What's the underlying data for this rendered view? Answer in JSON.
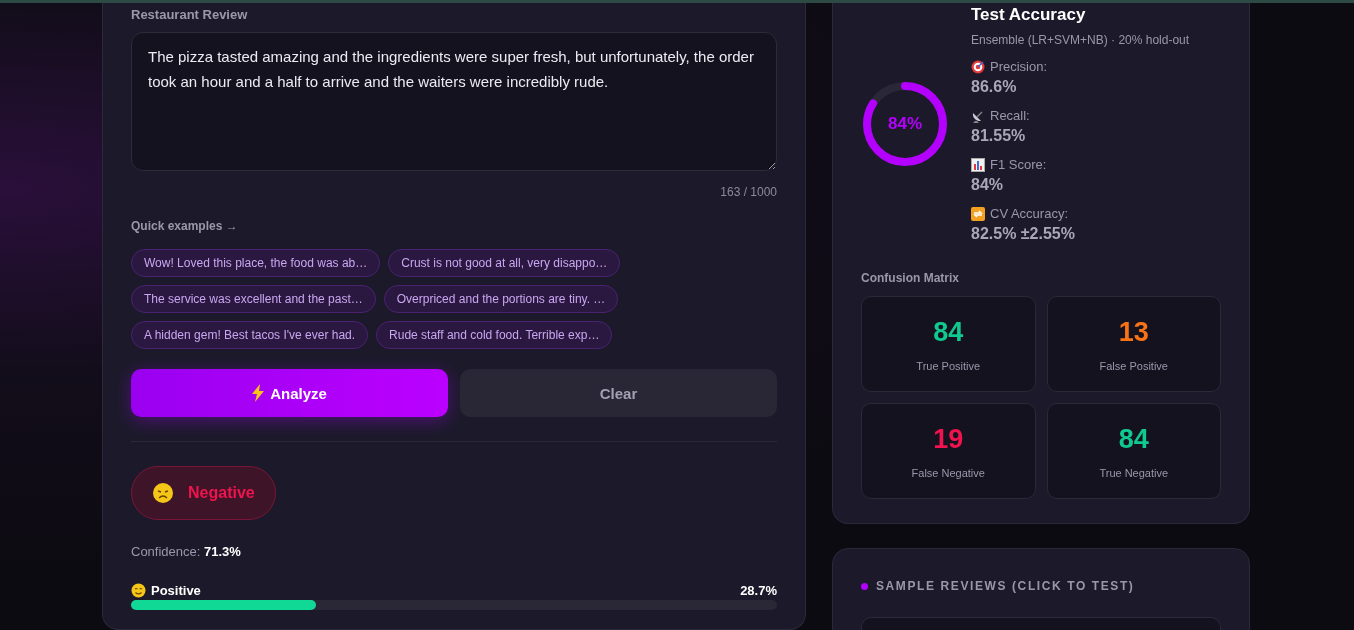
{
  "review_form": {
    "label": "Restaurant Review",
    "text": "The pizza tasted amazing and the ingredients were super fresh, but unfortunately, the order took an hour and a half to arrive and the waiters were incredibly rude.",
    "counter": "163 / 1000",
    "examples_label": "Quick examples →",
    "examples": [
      [
        "Wow! Loved this place, the food was ab…",
        "Crust is not good at all, very disappo…"
      ],
      [
        "The service was excellent and the past…",
        "Overpriced and the portions are tiny. …"
      ],
      [
        "A hidden gem! Best tacos I've ever had.",
        "Rude staff and cold food. Terrible exp…"
      ]
    ],
    "buttons": [
      {
        "kind": "primary",
        "label": "Analyze"
      },
      {
        "kind": "secondary",
        "label": "Clear"
      }
    ]
  },
  "result": {
    "sentiment": {
      "kind": "negative",
      "label": "Negative"
    },
    "confidence_label": "Confidence:",
    "confidence_value": "71.3%",
    "bars": [
      {
        "kind": "positive",
        "label": "Positive",
        "reading": "28.7%",
        "level": 0.287
      }
    ]
  },
  "metrics": {
    "title": "Test Accuracy",
    "subtitle": "Ensemble (LR+SVM+NB) · 20% hold-out",
    "accuracy": {
      "reading": "84%",
      "level": 0.84
    },
    "items": [
      {
        "kind": "target",
        "label": "Precision:",
        "value": "86.6%"
      },
      {
        "kind": "dish",
        "label": "Recall:",
        "value": "81.55%"
      },
      {
        "kind": "chart",
        "label": "F1 Score:",
        "value": "84%"
      },
      {
        "kind": "repeat",
        "label": "CV Accuracy:",
        "value": "82.5% ±2.55%"
      }
    ],
    "matrix_title": "Confusion Matrix",
    "matrix": [
      {
        "value": "84",
        "label": "True Positive",
        "color": "#10c98f"
      },
      {
        "value": "13",
        "label": "False Positive",
        "color": "#f97316"
      },
      {
        "value": "19",
        "label": "False Negative",
        "color": "#f0134d"
      },
      {
        "value": "84",
        "label": "True Negative",
        "color": "#10c98f"
      }
    ]
  },
  "samples": {
    "title": "SAMPLE REVIEWS (CLICK TO TEST)"
  }
}
